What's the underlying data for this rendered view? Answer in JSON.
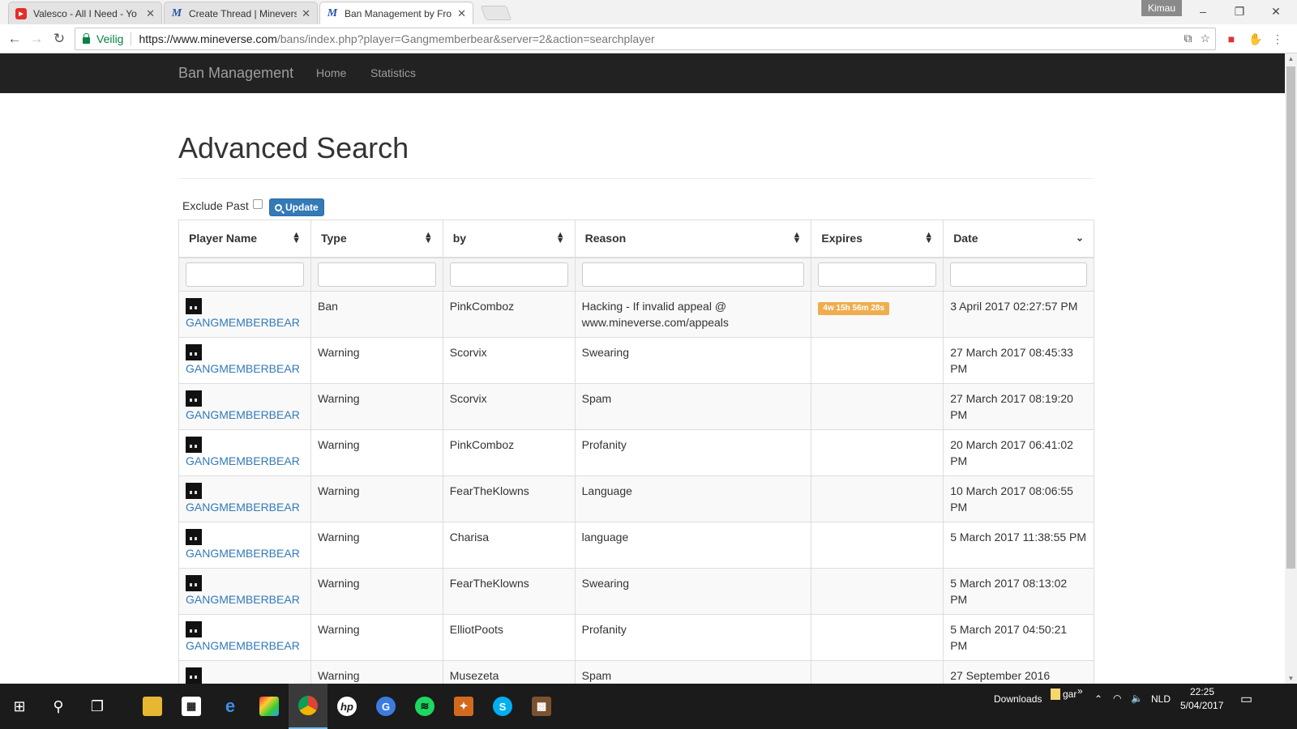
{
  "browser": {
    "tabs": [
      {
        "label": "Valesco - All I Need - Yo",
        "favicon": "youtube-icon",
        "active": false
      },
      {
        "label": "Create Thread | Minevers",
        "favicon": "mineverse-icon",
        "active": false
      },
      {
        "label": "Ban Management by Fro",
        "favicon": "mineverse-icon",
        "active": true
      }
    ],
    "profile_name": "Kimau",
    "secure_label": "Veilig",
    "url_host": "https://www.mineverse.com",
    "url_rest": "/bans/index.php?player=Gangmemberbear&server=2&action=searchplayer"
  },
  "navbar": {
    "brand": "Ban Management",
    "links": [
      "Home",
      "Statistics"
    ]
  },
  "page": {
    "title": "Advanced Search",
    "exclude_past_label": "Exclude Past",
    "update_label": "Update"
  },
  "table": {
    "columns": [
      "Player Name",
      "Type",
      "by",
      "Reason",
      "Expires",
      "Date"
    ],
    "rows": [
      {
        "player": "GANGMEMBERBEAR",
        "type": "Ban",
        "by": "PinkComboz",
        "reason": "Hacking - If invalid appeal @ www.mineverse.com/appeals",
        "expires": "4w 15h 56m 28s",
        "date": "3 April 2017 02:27:57 PM"
      },
      {
        "player": "GANGMEMBERBEAR",
        "type": "Warning",
        "by": "Scorvix",
        "reason": "Swearing",
        "expires": "",
        "date": "27 March 2017 08:45:33 PM"
      },
      {
        "player": "GANGMEMBERBEAR",
        "type": "Warning",
        "by": "Scorvix",
        "reason": "Spam",
        "expires": "",
        "date": "27 March 2017 08:19:20 PM"
      },
      {
        "player": "GANGMEMBERBEAR",
        "type": "Warning",
        "by": "PinkComboz",
        "reason": "Profanity",
        "expires": "",
        "date": "20 March 2017 06:41:02 PM"
      },
      {
        "player": "GANGMEMBERBEAR",
        "type": "Warning",
        "by": "FearTheKlowns",
        "reason": "Language",
        "expires": "",
        "date": "10 March 2017 08:06:55 PM"
      },
      {
        "player": "GANGMEMBERBEAR",
        "type": "Warning",
        "by": "Charisa",
        "reason": "language",
        "expires": "",
        "date": "5 March 2017 11:38:55 PM"
      },
      {
        "player": "GANGMEMBERBEAR",
        "type": "Warning",
        "by": "FearTheKlowns",
        "reason": "Swearing",
        "expires": "",
        "date": "5 March 2017 08:13:02 PM"
      },
      {
        "player": "GANGMEMBERBEAR",
        "type": "Warning",
        "by": "ElliotPoots",
        "reason": "Profanity",
        "expires": "",
        "date": "5 March 2017 04:50:21 PM"
      },
      {
        "player": "",
        "type": "Warning",
        "by": "Musezeta",
        "reason": "Spam",
        "expires": "",
        "date": "27 September 2016"
      }
    ]
  },
  "taskbar": {
    "downloads_label": "Downloads",
    "folder_label": "gar",
    "language": "NLD",
    "time": "22:25",
    "date": "5/04/2017"
  },
  "colors": {
    "navbar": "#222222",
    "link": "#337ab7",
    "expires_badge": "#f0ad4e",
    "button": "#337ab7"
  }
}
